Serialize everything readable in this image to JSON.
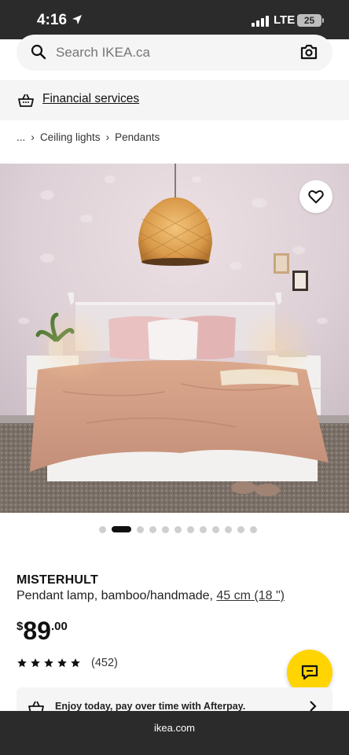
{
  "status_bar": {
    "time": "4:16",
    "network": "LTE",
    "battery": "25"
  },
  "search": {
    "placeholder": "Search IKEA.ca"
  },
  "financial": {
    "label": "Financial services"
  },
  "breadcrumb": {
    "ellipsis": "...",
    "items": [
      "Ceiling lights",
      "Pendants"
    ]
  },
  "gallery": {
    "total_images": 12,
    "active_index": 1
  },
  "product": {
    "name": "MISTERHULT",
    "description": "Pendant lamp, bamboo/handmade,",
    "size_link": "45 cm (18 \")",
    "price_currency": "$",
    "price_whole": "89",
    "price_decimal": ".00",
    "rating_value": 5,
    "rating_count": "(452)"
  },
  "afterpay": {
    "text": "Enjoy today, pay over time with Afterpay."
  },
  "browser": {
    "url": "ikea.com"
  },
  "colors": {
    "accent_yellow": "#ffd400",
    "chrome_dark": "#2b2b2b",
    "panel_gray": "#f5f5f5"
  }
}
